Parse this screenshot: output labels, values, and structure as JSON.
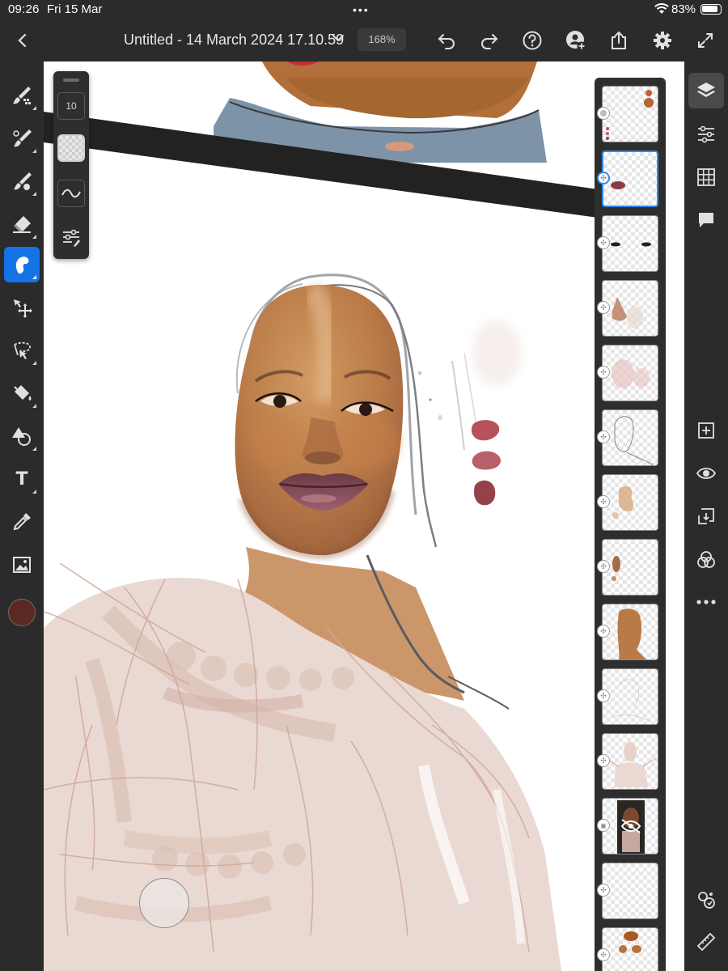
{
  "status": {
    "time": "09:26",
    "date": "Fri 15 Mar",
    "battery": "83%",
    "battery_level": 0.83
  },
  "toolbar": {
    "back_icon": "chevron-left-icon",
    "document_title": "Untitled - 14 March 2024 17.10.59",
    "zoom": "168%",
    "actions": [
      "undo-icon",
      "redo-icon",
      "help-icon",
      "invite-icon",
      "share-icon",
      "settings-icon",
      "fullscreen-icon"
    ]
  },
  "tools": [
    {
      "name": "pixel-brush",
      "icon": "pixel-brush-icon"
    },
    {
      "name": "live-brush",
      "icon": "live-brush-icon"
    },
    {
      "name": "mixer-brush",
      "icon": "mixer-brush-icon"
    },
    {
      "name": "eraser",
      "icon": "eraser-icon"
    },
    {
      "name": "smudge",
      "icon": "smudge-icon",
      "active": true
    },
    {
      "name": "transform",
      "icon": "move-icon"
    },
    {
      "name": "selection",
      "icon": "lasso-icon"
    },
    {
      "name": "fill",
      "icon": "paint-bucket-icon"
    },
    {
      "name": "shape",
      "icon": "shape-icon"
    },
    {
      "name": "text",
      "icon": "text-icon",
      "label": "T"
    },
    {
      "name": "eyedropper",
      "icon": "eyedropper-icon"
    },
    {
      "name": "place-image",
      "icon": "image-icon"
    }
  ],
  "current_color": "#5a2a22",
  "brush_panel": {
    "size": "10",
    "opacity_icon": "opacity-icon",
    "smoothing_icon": "smoothing-icon",
    "settings_icon": "brush-settings-icon"
  },
  "layers": {
    "selected_index": 1,
    "items": [
      {
        "name": "layer-swatches"
      },
      {
        "name": "layer-lips"
      },
      {
        "name": "layer-eyes"
      },
      {
        "name": "layer-nose"
      },
      {
        "name": "layer-blush"
      },
      {
        "name": "layer-sketch"
      },
      {
        "name": "layer-highlights"
      },
      {
        "name": "layer-ear"
      },
      {
        "name": "layer-skin-base"
      },
      {
        "name": "layer-line-sketch"
      },
      {
        "name": "layer-body-sketch"
      },
      {
        "name": "layer-reference-photo",
        "hidden": true
      },
      {
        "name": "layer-empty"
      },
      {
        "name": "layer-colors"
      }
    ]
  },
  "right_rail": [
    "layers-icon",
    "adjustments-icon",
    "grid-icon",
    "comment-icon",
    "add-layer-icon",
    "visibility-icon",
    "merge-down-icon",
    "blend-modes-icon",
    "more-icon",
    "touch-shortcut-icon",
    "ruler-icon"
  ],
  "colors": {
    "accent": "#1473e6",
    "selected_layer": "#2d8ceb",
    "chrome": "#2b2b2b"
  }
}
